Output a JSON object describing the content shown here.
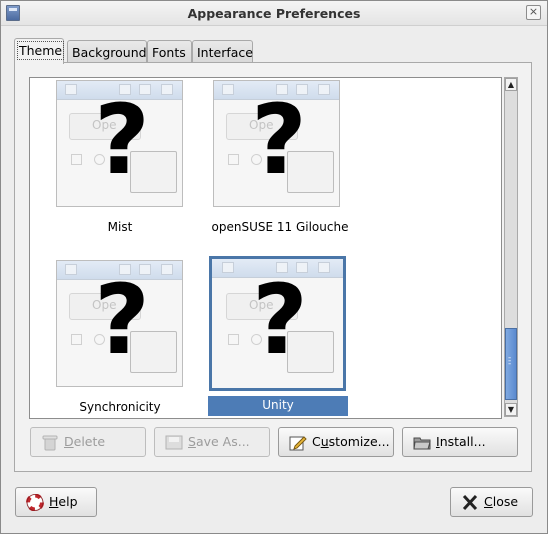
{
  "window": {
    "title": "Appearance Preferences",
    "close_glyph": "⨯"
  },
  "tabs": [
    {
      "label": "Theme",
      "active": true
    },
    {
      "label": "Background"
    },
    {
      "label": "Fonts"
    },
    {
      "label": "Interface"
    }
  ],
  "themes": [
    {
      "name": "Mist",
      "preview_button": "Ope",
      "placeholder": "?"
    },
    {
      "name": "openSUSE 11 Gilouche",
      "preview_button": "Ope",
      "placeholder": "?"
    },
    {
      "name": "Synchronicity",
      "preview_button": "Ope",
      "placeholder": "?"
    },
    {
      "name": "Unity",
      "preview_button": "Ope",
      "placeholder": "?",
      "selected": true
    }
  ],
  "actions": {
    "delete": {
      "mnemonic": "D",
      "rest": "elete",
      "icon": "trash-icon",
      "enabled": false
    },
    "save_as": {
      "mnemonic": "S",
      "rest": "ave As...",
      "icon": "save-as-icon",
      "enabled": false
    },
    "customize": {
      "pre": "C",
      "mnemonic": "u",
      "rest": "stomize...",
      "icon": "edit-icon"
    },
    "install": {
      "mnemonic": "I",
      "rest": "nstall...",
      "icon": "folder-icon"
    }
  },
  "footer": {
    "help": {
      "mnemonic": "H",
      "rest": "elp",
      "icon": "lifebuoy-icon"
    },
    "close": {
      "mnemonic": "C",
      "rest": "lose",
      "icon": "close-x-icon"
    }
  },
  "colors": {
    "selection": "#4d7cb6",
    "scroll_thumb": "#6b98d8",
    "window_bg": "#ededed"
  }
}
